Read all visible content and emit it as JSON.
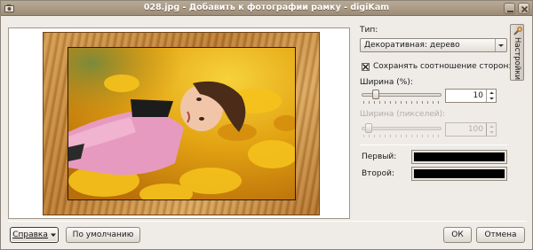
{
  "window": {
    "title": "028.jpg - Добавить к фотографии рамку - digiKam"
  },
  "settings": {
    "type_label": "Тип:",
    "type_value": "Декоративная: дерево",
    "keep_ratio_label": "Сохранять соотношение сторон:",
    "keep_ratio_checked": true,
    "width_percent_label": "Ширина (%):",
    "width_percent_value": "10",
    "width_percent_slider": 0.1,
    "width_pixels_label": "Ширина (пикселей):",
    "width_pixels_value": "100",
    "width_pixels_enabled": false,
    "first_color_label": "Первый:",
    "first_color": "#000000",
    "second_color_label": "Второй:",
    "second_color": "#000000",
    "side_tab_label": "Настройки"
  },
  "buttons": {
    "help": "Справка",
    "defaults": "По умолчанию",
    "ok": "ОК",
    "cancel": "Отмена"
  },
  "preview": {
    "frame_style": "wood",
    "frame_color": "#c3853a"
  }
}
